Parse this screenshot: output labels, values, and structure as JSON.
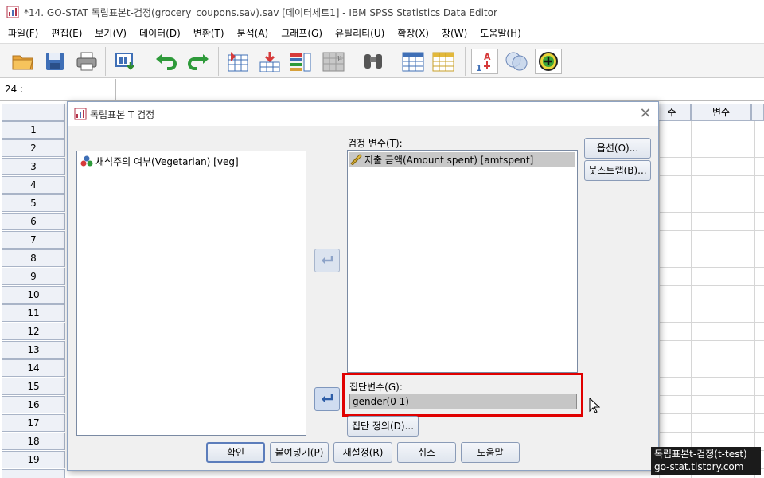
{
  "window": {
    "title": "*14. GO-STAT 독립표본t-검정(grocery_coupons.sav).sav [데이터세트1] - IBM SPSS Statistics Data Editor"
  },
  "menu": [
    {
      "label": "파일(F)"
    },
    {
      "label": "편집(E)"
    },
    {
      "label": "보기(V)"
    },
    {
      "label": "데이터(D)"
    },
    {
      "label": "변환(T)"
    },
    {
      "label": "분석(A)"
    },
    {
      "label": "그래프(G)"
    },
    {
      "label": "유틸리티(U)"
    },
    {
      "label": "확장(X)"
    },
    {
      "label": "창(W)"
    },
    {
      "label": "도움말(H)"
    }
  ],
  "toolbar": {
    "icons": [
      "open-folder-icon",
      "save-icon",
      "print-icon",
      "dialog-recall-icon",
      "undo-icon",
      "redo-icon",
      "goto-case-icon",
      "goto-variable-icon",
      "variables-icon",
      "run-descriptive-icon",
      "find-icon",
      "insert-cases-icon",
      "insert-variable-icon",
      "split-file-icon",
      "value-labels-icon",
      "use-sets-icon",
      "add-ons-icon"
    ]
  },
  "cell_reference": "24 :",
  "grid": {
    "row_numbers": [
      "1",
      "2",
      "3",
      "4",
      "5",
      "6",
      "7",
      "8",
      "9",
      "10",
      "11",
      "12",
      "13",
      "14",
      "15",
      "16",
      "17",
      "18",
      "19"
    ],
    "column_headers": [
      "수",
      "변수"
    ]
  },
  "dialog": {
    "title": "독립표본 T 검정",
    "source_list": [
      {
        "label": "채식주의 여부(Vegetarian) [veg]"
      }
    ],
    "test_variables_label": "검정 변수(T):",
    "test_variables": [
      {
        "label": "지출 금액(Amount spent) [amtspent]"
      }
    ],
    "grouping_variable_label": "집단변수(G):",
    "grouping_variable_value": "gender(0 1)",
    "define_groups_button": "집단 정의(D)...",
    "options_button": "옵션(O)...",
    "bootstrap_button": "붓스트랩(B)...",
    "buttons": {
      "ok": "확인",
      "paste": "붙여넣기(P)",
      "reset": "재설정(R)",
      "cancel": "취소",
      "help": "도움말"
    }
  },
  "watermark": {
    "line1": "독립표본t-검정(t-test)",
    "line2": "go-stat.tistory.com"
  },
  "colors": {
    "highlight": "#e00000",
    "selection": "#c8c8c8"
  }
}
